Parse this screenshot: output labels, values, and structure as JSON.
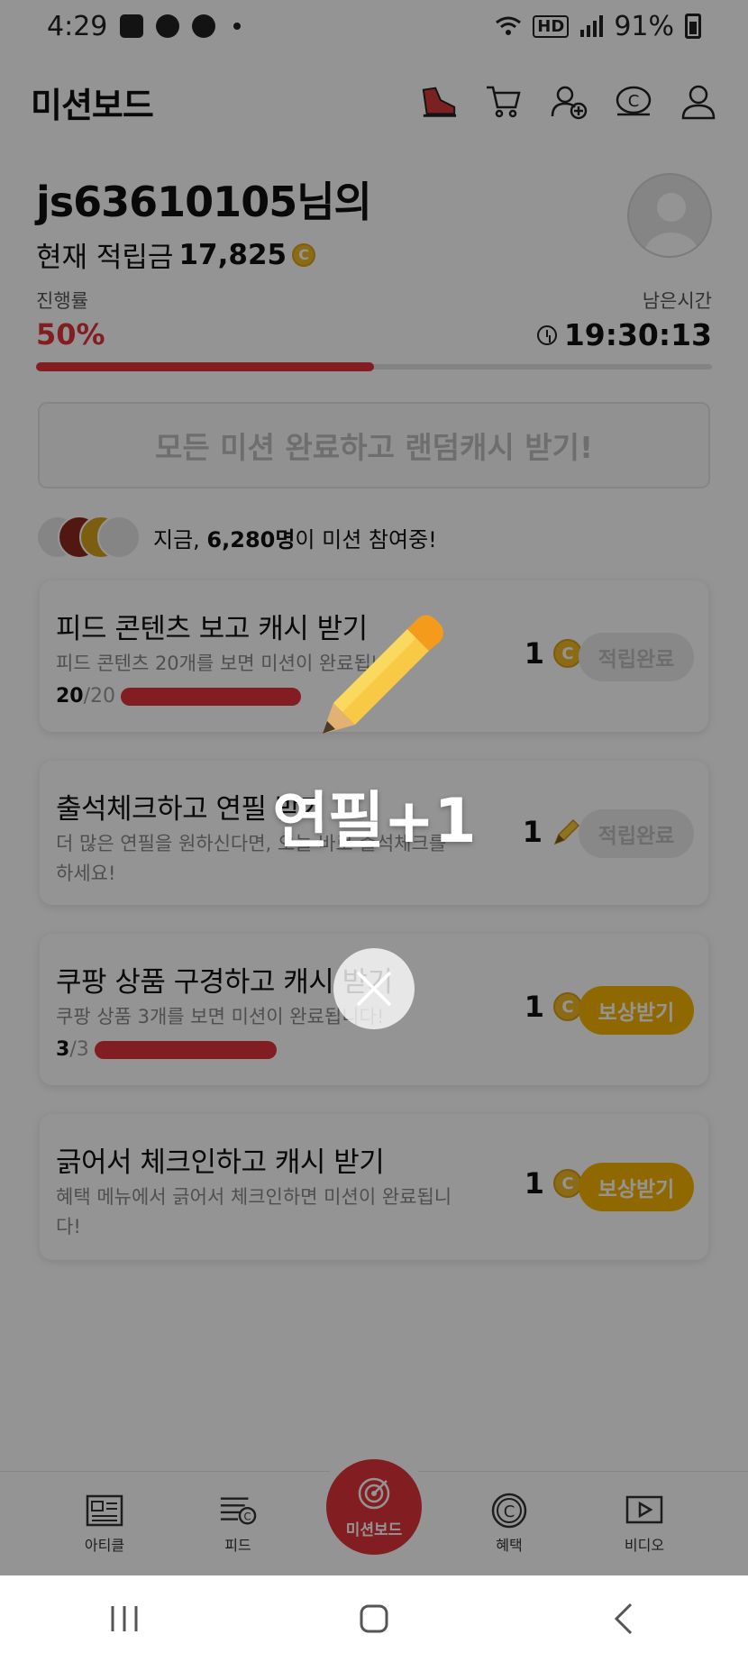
{
  "status_bar": {
    "time": "4:29",
    "network_badge": "HD",
    "battery": "91%"
  },
  "header": {
    "title": "미션보드",
    "icons": [
      "shoe-icon",
      "cart-icon",
      "add-friend-icon",
      "cash-icon",
      "profile-icon"
    ]
  },
  "profile": {
    "username": "js63610105님의",
    "balance_label": "현재 적립금",
    "balance_value": "17,825",
    "coin_symbol": "C"
  },
  "progress": {
    "label": "진행률",
    "value": "50%",
    "fraction": 0.5,
    "remaining_label": "남은시간",
    "remaining_time": "19:30:13"
  },
  "banner": {
    "text": "모든 미션 완료하고 랜덤캐시 받기!"
  },
  "participants": {
    "prefix": "지금, ",
    "count": "6,280명",
    "suffix": "이 미션 참여중!"
  },
  "missions": [
    {
      "title": "피드 콘텐츠 보고 캐시 받기",
      "desc": "피드 콘텐츠 20개를 보면 미션이 완료됩니다!",
      "count_done": "20",
      "count_total": "/20",
      "progress": 1.0,
      "reward": "1",
      "reward_type": "coin",
      "button": "적립완료",
      "status": "done"
    },
    {
      "title": "출석체크하고 연필 받기",
      "desc": "더 많은 연필을 원하신다면, 오늘 바로 출석체크를 하세요!",
      "reward": "1",
      "reward_type": "pencil",
      "button": "적립완료",
      "status": "done"
    },
    {
      "title": "쿠팡 상품 구경하고 캐시 받기",
      "desc": "쿠팡 상품 3개를 보면 미션이 완료됩니다!",
      "count_done": "3",
      "count_total": "/3",
      "progress": 1.0,
      "reward": "1",
      "reward_type": "coin",
      "button": "보상받기",
      "status": "claim"
    },
    {
      "title": "긁어서 체크인하고 캐시 받기",
      "desc": "혜택 메뉴에서 긁어서 체크인하면 미션이 완료됩니다!",
      "reward": "1",
      "reward_type": "coin",
      "button": "보상받기",
      "status": "claim"
    }
  ],
  "bottom_nav": {
    "items": [
      {
        "label": "아티클",
        "icon": "article-icon"
      },
      {
        "label": "피드",
        "icon": "feed-icon"
      },
      {
        "label": "미션보드",
        "icon": "target-icon"
      },
      {
        "label": "혜택",
        "icon": "benefit-icon"
      },
      {
        "label": "비디오",
        "icon": "video-icon"
      }
    ]
  },
  "popup": {
    "text": "연필+1",
    "icon": "pencil-icon"
  },
  "colors": {
    "accent_red": "#e0353a",
    "gold": "#f7b500",
    "overlay": "rgba(0,0,0,0.42)"
  }
}
